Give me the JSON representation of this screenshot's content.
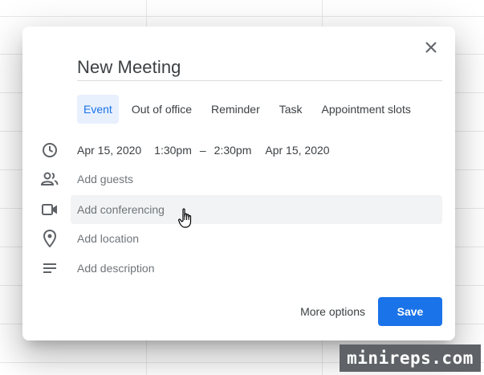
{
  "dialog": {
    "title": "New Meeting",
    "close_icon": "close-icon"
  },
  "tabs": [
    {
      "label": "Event",
      "active": true
    },
    {
      "label": "Out of office",
      "active": false
    },
    {
      "label": "Reminder",
      "active": false
    },
    {
      "label": "Task",
      "active": false
    },
    {
      "label": "Appointment slots",
      "active": false
    }
  ],
  "datetime": {
    "start_date": "Apr 15, 2020",
    "start_time": "1:30pm",
    "separator": "–",
    "end_time": "2:30pm",
    "end_date": "Apr 15, 2020",
    "icon": "clock-icon"
  },
  "fields": {
    "guests": {
      "placeholder": "Add guests",
      "icon": "people-icon"
    },
    "conferencing": {
      "placeholder": "Add conferencing",
      "icon": "video-camera-icon"
    },
    "location": {
      "placeholder": "Add location",
      "icon": "location-pin-icon"
    },
    "description": {
      "placeholder": "Add description",
      "icon": "notes-icon"
    }
  },
  "footer": {
    "more_options": "More options",
    "save": "Save"
  },
  "colors": {
    "accent": "#1a73e8",
    "active_tab_bg": "#e8f0fe",
    "hover_row_bg": "#f1f3f4"
  },
  "watermark": "minireps.com"
}
